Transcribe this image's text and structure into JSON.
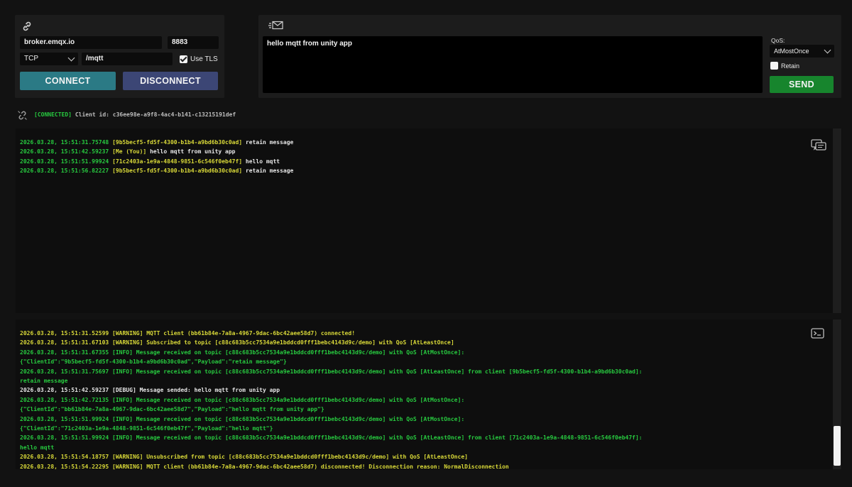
{
  "connection": {
    "host": "broker.emqx.io",
    "port": "8883",
    "protocol": "TCP",
    "path": "/mqtt",
    "use_tls_label": "Use TLS",
    "use_tls_checked": true,
    "connect_label": "CONNECT",
    "disconnect_label": "DISCONNECT",
    "icon": "link-icon"
  },
  "publish": {
    "icon": "envelope-icon",
    "message": "hello mqtt from unity app",
    "qos_label": "QoS:",
    "qos_value": "AtMostOnce",
    "retain_label": "Retain",
    "retain_checked": false,
    "send_label": "SEND"
  },
  "status": {
    "icon": "broken-link-icon",
    "tag": "[CONNECTED]",
    "client_id": "Client id: c36ee98e-a9f8-4ac4-b141-c13215191def"
  },
  "chat_log": [
    {
      "time": "2026.03.28, 15:51:31.75748",
      "sender": "[9b5becf5-fd5f-4300-b1b4-a9bd6b30c0ad]",
      "text": "retain message"
    },
    {
      "time": "2026.03.28, 15:51:42.59237",
      "sender": "[Me (You)]",
      "text": "hello mqtt from unity app"
    },
    {
      "time": "2026.03.28, 15:51:51.99924",
      "sender": "[71c2403a-1e9a-4848-9851-6c546f0eb47f]",
      "text": "hello mqtt"
    },
    {
      "time": "2026.03.28, 15:51:56.82227",
      "sender": "[9b5becf5-fd5f-4300-b1b4-a9bd6b30c0ad]",
      "text": "retain message"
    }
  ],
  "console_log": [
    {
      "level": "warning",
      "text": "2026.03.28, 15:51:31.52599 [WARNING] MQTT client (bb61b84e-7a8a-4967-9dac-6bc42aee58d7) connected!"
    },
    {
      "level": "warning",
      "text": "2026.03.28, 15:51:31.67103 [WARNING] Subscribed to topic [c88c683b5cc7534a9e1bddcd0fff1bebc4143d9c/demo] with QoS [AtLeastOnce]"
    },
    {
      "level": "info",
      "text": "2026.03.28, 15:51:31.67355 [INFO] Message received on topic [c88c683b5cc7534a9e1bddcd0fff1bebc4143d9c/demo] with QoS [AtMostOnce]:"
    },
    {
      "level": "info",
      "text": "{\"ClientId\":\"9b5becf5-fd5f-4300-b1b4-a9bd6b30c0ad\",\"Payload\":\"retain message\"}"
    },
    {
      "level": "info",
      "text": "2026.03.28, 15:51:31.75697 [INFO] Message received on topic [c88c683b5cc7534a9e1bddcd0fff1bebc4143d9c/demo] with QoS [AtLeastOnce] from client [9b5becf5-fd5f-4300-b1b4-a9bd6b30c0ad]:"
    },
    {
      "level": "info",
      "text": "retain message"
    },
    {
      "level": "debug",
      "text": "2026.03.28, 15:51:42.59237 [DEBUG] Message sended: hello mqtt from unity app"
    },
    {
      "level": "info",
      "text": "2026.03.28, 15:51:42.72135 [INFO] Message received on topic [c88c683b5cc7534a9e1bddcd0fff1bebc4143d9c/demo] with QoS [AtMostOnce]:"
    },
    {
      "level": "info",
      "text": "{\"ClientId\":\"bb61b84e-7a8a-4967-9dac-6bc42aee58d7\",\"Payload\":\"hello mqtt from unity app\"}"
    },
    {
      "level": "info",
      "text": "2026.03.28, 15:51:51.99924 [INFO] Message received on topic [c88c683b5cc7534a9e1bddcd0fff1bebc4143d9c/demo] with QoS [AtMostOnce]:"
    },
    {
      "level": "info",
      "text": "{\"ClientId\":\"71c2403a-1e9a-4848-9851-6c546f0eb47f\",\"Payload\":\"hello mqtt\"}"
    },
    {
      "level": "info",
      "text": "2026.03.28, 15:51:51.99924 [INFO] Message received on topic [c88c683b5cc7534a9e1bddcd0fff1bebc4143d9c/demo] with QoS [AtLeastOnce] from client [71c2403a-1e9a-4848-9851-6c546f0eb47f]:"
    },
    {
      "level": "info",
      "text": "hello mqtt"
    },
    {
      "level": "warning",
      "text": "2026.03.28, 15:51:54.18757 [WARNING] Unsubscribed from topic [c88c683b5cc7534a9e1bddcd0fff1bebc4143d9c/demo] with QoS [AtLeastOnce]"
    },
    {
      "level": "warning",
      "text": "2026.03.28, 15:51:54.22295 [WARNING] MQTT client (bb61b84e-7a8a-4967-9dac-6bc42aee58d7) disconnected! Disconnection reason: NormalDisconnection"
    }
  ],
  "chat_icon": "chat-bubbles-icon",
  "console_icon": "terminal-icon",
  "colors": {
    "connect": "#2b7a85",
    "disconnect": "#3c4675",
    "send": "#17852d",
    "info": "#27c93f",
    "warning": "#d8d838"
  }
}
